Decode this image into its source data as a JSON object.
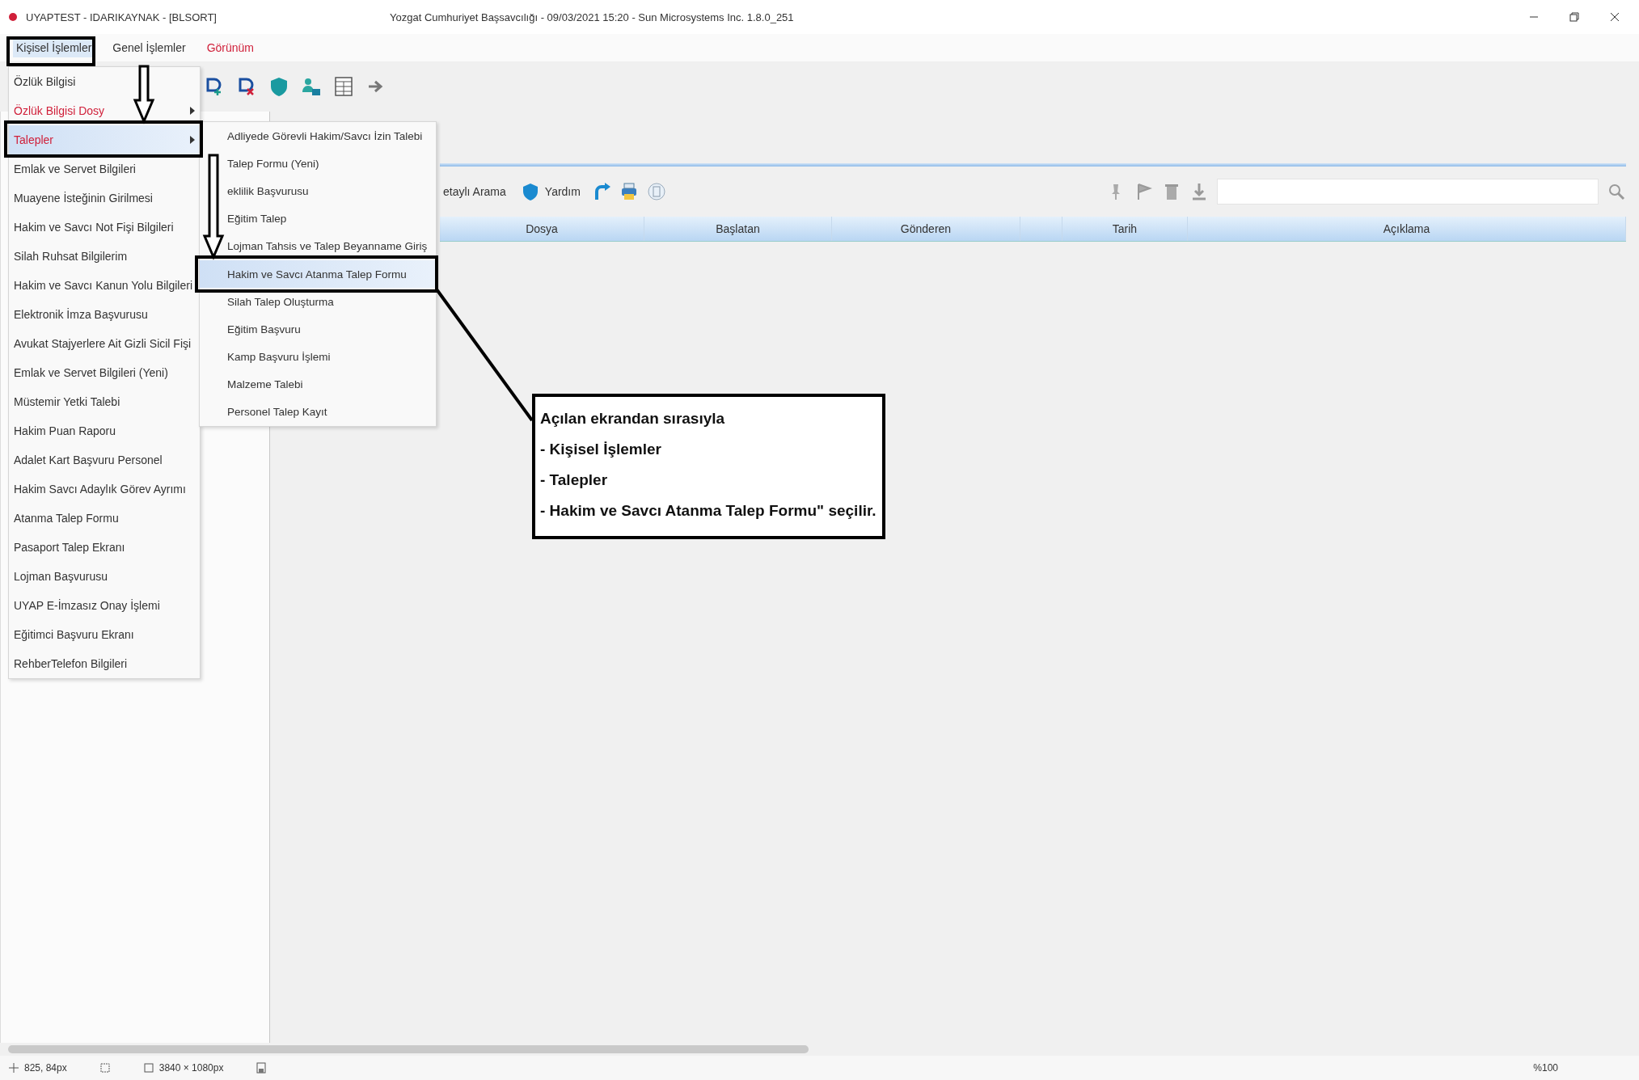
{
  "window": {
    "title": "UYAPTEST - IDARIKAYNAK - [BLSORT]",
    "subtitle": "Yozgat Cumhuriyet Başsavcılığı - 09/03/2021 15:20 - Sun Microsystems Inc. 1.8.0_251"
  },
  "menubar": [
    {
      "label": "Kişisel İşlemler",
      "kind": "normal",
      "selected": true
    },
    {
      "label": "Genel İşlemler",
      "kind": "normal",
      "selected": false
    },
    {
      "label": "Görünüm",
      "kind": "red",
      "selected": false
    }
  ],
  "menu": {
    "items": [
      {
        "label": "Özlük Bilgisi",
        "kind": "normal",
        "submenu": false,
        "selected": false
      },
      {
        "label": "Özlük Bilgisi Dosy",
        "kind": "red",
        "submenu": true,
        "selected": false
      },
      {
        "label": "Talepler",
        "kind": "red",
        "submenu": true,
        "selected": true
      },
      {
        "label": "Emlak ve Servet Bilgileri",
        "kind": "normal",
        "submenu": false,
        "selected": false
      },
      {
        "label": "Muayene İsteğinin Girilmesi",
        "kind": "normal",
        "submenu": false,
        "selected": false
      },
      {
        "label": "Hakim ve Savcı Not Fişi Bilgileri",
        "kind": "normal",
        "submenu": false,
        "selected": false
      },
      {
        "label": "Silah Ruhsat Bilgilerim",
        "kind": "normal",
        "submenu": false,
        "selected": false
      },
      {
        "label": "Hakim ve Savcı Kanun Yolu Bilgileri",
        "kind": "normal",
        "submenu": false,
        "selected": false
      },
      {
        "label": "Elektronik İmza Başvurusu",
        "kind": "normal",
        "submenu": false,
        "selected": false
      },
      {
        "label": "Avukat Stajyerlere Ait Gizli Sicil Fişi",
        "kind": "normal",
        "submenu": false,
        "selected": false
      },
      {
        "label": "Emlak ve Servet Bilgileri (Yeni)",
        "kind": "normal",
        "submenu": false,
        "selected": false
      },
      {
        "label": "Müstemir Yetki Talebi",
        "kind": "normal",
        "submenu": false,
        "selected": false
      },
      {
        "label": "Hakim Puan Raporu",
        "kind": "normal",
        "submenu": false,
        "selected": false
      },
      {
        "label": "Adalet Kart Başvuru Personel",
        "kind": "normal",
        "submenu": false,
        "selected": false
      },
      {
        "label": "Hakim Savcı Adaylık Görev Ayrımı",
        "kind": "normal",
        "submenu": false,
        "selected": false
      },
      {
        "label": "Atanma Talep Formu",
        "kind": "normal",
        "submenu": false,
        "selected": false
      },
      {
        "label": "Pasaport Talep Ekranı",
        "kind": "normal",
        "submenu": false,
        "selected": false
      },
      {
        "label": "Lojman Başvurusu",
        "kind": "normal",
        "submenu": false,
        "selected": false
      },
      {
        "label": "UYAP E-İmzasız Onay İşlemi",
        "kind": "normal",
        "submenu": false,
        "selected": false
      },
      {
        "label": "Eğitimci Başvuru Ekranı",
        "kind": "normal",
        "submenu": false,
        "selected": false
      },
      {
        "label": "RehberTelefon Bilgileri",
        "kind": "normal",
        "submenu": false,
        "selected": false
      }
    ]
  },
  "submenu": {
    "items": [
      {
        "label": "Adliyede Görevli Hakim/Savcı İzin Talebi",
        "selected": false
      },
      {
        "label": "Talep Formu (Yeni)",
        "selected": false
      },
      {
        "label": "eklilik Başvurusu",
        "selected": false
      },
      {
        "label": "Eğitim Talep",
        "selected": false
      },
      {
        "label": "Lojman Tahsis ve Talep Beyanname Giriş",
        "selected": false
      },
      {
        "label": "Hakim ve Savcı Atanma Talep Formu",
        "selected": true
      },
      {
        "label": "Silah Talep Oluşturma",
        "selected": false
      },
      {
        "label": "Eğitim Başvuru",
        "selected": false
      },
      {
        "label": "Kamp Başvuru İşlemi",
        "selected": false
      },
      {
        "label": "Malzeme Talebi",
        "selected": false
      },
      {
        "label": "Personel Talep Kayıt",
        "selected": false
      }
    ]
  },
  "panel": {
    "search_button": "etaylı Arama",
    "help_button": "Yardım"
  },
  "table": {
    "columns": [
      "Dosya",
      "Başlatan",
      "Gönderen",
      "Tarih",
      "Açıklama"
    ]
  },
  "callout": {
    "lines": [
      "Açılan ekrandan sırasıyla",
      "- Kişisel İşlemler",
      "- Talepler",
      "- Hakim ve Savcı Atanma Talep Formu\" seçilir."
    ]
  },
  "status_bar": {
    "cursor": "825, 84px",
    "dimensions": "3840 × 1080px",
    "zoom": "%100"
  }
}
